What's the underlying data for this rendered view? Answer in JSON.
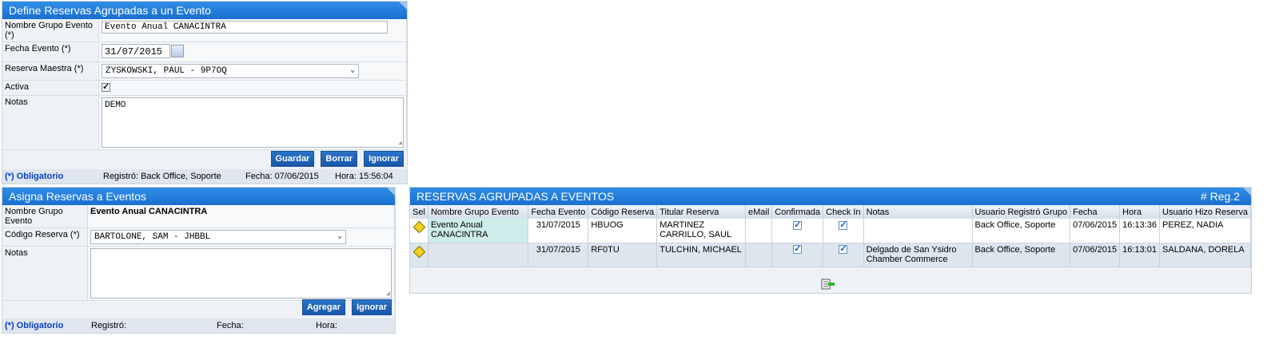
{
  "define_panel": {
    "title": "Define Reservas Agrupadas a un Evento",
    "nombre_label": "Nombre Grupo Evento (*)",
    "nombre_value": "Evento Anual CANACINTRA",
    "fecha_label": "Fecha Evento (*)",
    "fecha_value": "31/07/2015",
    "maestra_label": "Reserva Maestra (*)",
    "maestra_value": "ZYSKOWSKI, PAUL - 9P7OQ",
    "activa_label": "Activa",
    "activa_checked": true,
    "notas_label": "Notas",
    "notas_value": "DEMO",
    "buttons": {
      "guardar": "Guardar",
      "borrar": "Borrar",
      "ignorar": "Ignorar"
    },
    "footer": {
      "obligatorio": "(*) Obligatorio",
      "registro": "Registró: Back Office, Soporte",
      "fecha": "Fecha:  07/06/2015",
      "hora": "Hora:  15:56:04"
    }
  },
  "asigna_panel": {
    "title": "Asigna Reservas a Eventos",
    "nombre_label": "Nombre Grupo Evento",
    "nombre_value": "Evento Anual CANACINTRA",
    "codigo_label": "Código Reserva (*)",
    "codigo_value": "BARTOLONE, SAM - JHBBL",
    "notas_label": "Notas",
    "notas_value": "",
    "buttons": {
      "agregar": "Agregar",
      "ignorar": "Ignorar"
    },
    "footer": {
      "obligatorio": "(*) Obligatorio",
      "registro": "Registró:",
      "fecha": "Fecha:",
      "hora": "Hora:"
    }
  },
  "grid_panel": {
    "title": "RESERVAS AGRUPADAS A EVENTOS",
    "count": "# Reg.2",
    "columns": [
      "Sel",
      "Nombre Grupo Evento",
      "Fecha Evento",
      "Código Reserva",
      "Titular Reserva",
      "eMail",
      "Confirmada",
      "Check In",
      "Notas",
      "Usuario Registró Grupo",
      "Fecha",
      "Hora",
      "Usuario Hizo Reserva"
    ],
    "rows": [
      {
        "grupo": "Evento Anual CANACINTRA",
        "fecha_evento": "31/07/2015",
        "codigo": "HBUOG",
        "titular": "MARTINEZ CARRILLO, SAUL",
        "email": "",
        "confirmada": true,
        "checkin": true,
        "notas": "",
        "usuario_registro": "Back Office, Soporte",
        "fecha": "07/06/2015",
        "hora": "16:13:36",
        "usuario_reserva": "PEREZ, NADIA"
      },
      {
        "grupo": "",
        "fecha_evento": "31/07/2015",
        "codigo": "RF0TU",
        "titular": "TULCHIN, MICHAEL",
        "email": "",
        "confirmada": true,
        "checkin": true,
        "notas": "Delgado de San Ysidro Chamber Commerce",
        "usuario_registro": "Back Office, Soporte",
        "fecha": "07/06/2015",
        "hora": "16:13:01",
        "usuario_reserva": "SALDANA, DORELA"
      }
    ],
    "export_icon": "excel-export-icon"
  }
}
